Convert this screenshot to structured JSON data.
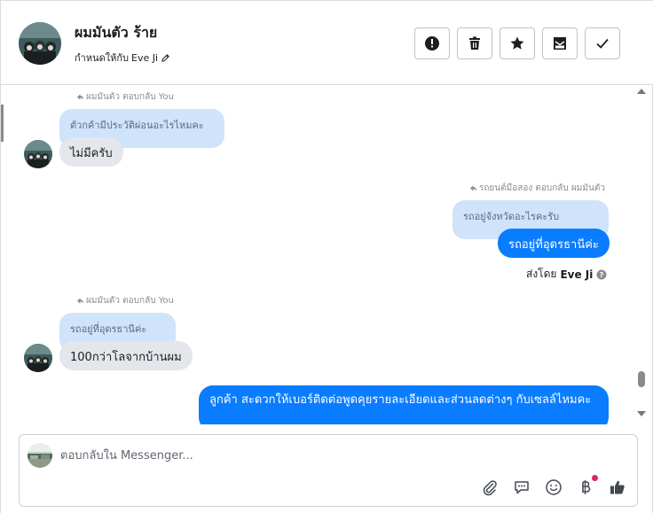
{
  "header": {
    "contact_name": "ผมมันตัว ร้าย",
    "assigned_label": "กำหนดให้กับ",
    "assigned_to": "Eve Ji"
  },
  "icons": {
    "spam": "exclamation-octagon-icon",
    "delete": "trash-icon",
    "star": "star-icon",
    "mark_unread": "envelope-icon",
    "done": "check-icon",
    "edit": "pencil-icon"
  },
  "messages": {
    "reply1": {
      "note": "ผมมันตัว ตอบกลับ You",
      "quote": "ตัวกค้ามีประวัติผ่อนอะไรไหมคะ",
      "text": "ไม่มีครับ"
    },
    "reply2": {
      "note": "รถยนต์มือสอง ตอบกลับ ผมมันตัว",
      "quote": "รถอยู่จังหวัดอะไรคะรับ",
      "text": "รถอยู่ที่อุดรธานีค่ะ"
    },
    "sent_by": {
      "label": "ส่งโดย",
      "name": "Eve Ji"
    },
    "reply3": {
      "note": "ผมมันตัว ตอบกลับ You",
      "quote": "รถอยู่ที่อุดรธานีค่ะ",
      "text": "100กว่าโลจากบ้านผม"
    },
    "outgoing_last": {
      "text": "ลูกค้า สะดวกให้เบอร์ติดต่อพูดคุยรายละเอียดและส่วนลดต่างๆ กับเซลล์ไหมคะ"
    }
  },
  "composer": {
    "placeholder": "ตอบกลับใน Messenger..."
  },
  "colors": {
    "outgoing_bubble": "#0a7cff",
    "incoming_bubble": "#e4e6eb",
    "quote_bubble": "#cfe3fb",
    "notification_dot": "#e0245e"
  }
}
